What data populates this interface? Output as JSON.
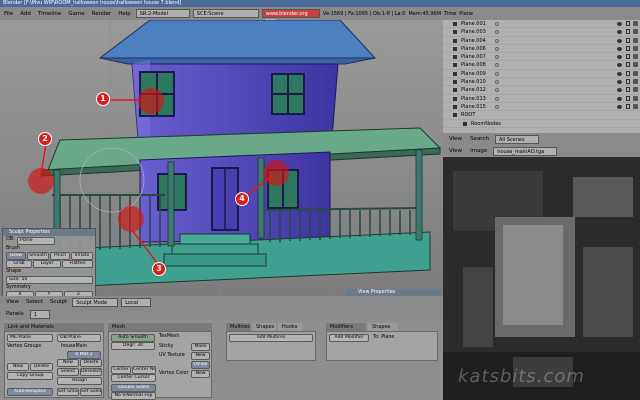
{
  "title_bar": "Blender [F:\\Mvu WIP\\ROOM_halloween house\\halloween house 7.blend]",
  "menu": [
    "File",
    "Add",
    "Timeline",
    "Game",
    "Render",
    "Help"
  ],
  "screen_field": "SR:2-Model",
  "scene_field": "SCE:Scene",
  "url_field": "www.blender.org 243",
  "stats": "Ve:1569 | Fa:1065 | Ob:1-8 | La:0",
  "mem": "Mem:45.96M",
  "time": "Time",
  "active_object": "Plane",
  "outliner": {
    "rows": [
      "Plane.001",
      "Plane.003",
      "Plane.004",
      "Plane.006",
      "Plane.007",
      "Plane.008",
      "Plane.009",
      "Plane.010",
      "Plane.012",
      "Plane.013",
      "Plane.015",
      "ROOT",
      "RoomNodes"
    ],
    "header": {
      "view": "View",
      "search": "Search",
      "scenes": "All Scenes"
    }
  },
  "image_editor": {
    "view": "View",
    "image": "Image",
    "file": "house_mainAO.tga"
  },
  "viewport3d_header": {
    "view": "View",
    "select": "Select",
    "sculpt": "Sculpt",
    "mode": "Sculpt Mode",
    "pivot": "Local"
  },
  "view_properties": "View Properties",
  "sculpt_props": {
    "title": "Sculpt Properties",
    "ob": "OB:",
    "ob_value": "Plane",
    "brush_label": "Brush",
    "brushes": [
      "Draw",
      "Smooth",
      "Pinch",
      "Inflate",
      "Grab",
      "Layer",
      "Flatten"
    ],
    "shape_label": "Shape",
    "size": "Size: 50",
    "symmetry_label": "Symmetry",
    "axes": [
      "X",
      "Y",
      "Z"
    ]
  },
  "buttons_header": {
    "panels": "Panels",
    "frame": "1"
  },
  "buttons": {
    "link_title": "Link and Materials",
    "me_field": "ME:Plane",
    "ob_field": "OB:Plane",
    "vertex_groups": "Vertex Groups",
    "house_main": "houseMain",
    "mat_count": "0 Mat 2",
    "new": "New",
    "delete": "Delete",
    "copy_group": "Copy Group",
    "select": "Select",
    "deselect": "Deselect",
    "assign": "Assign",
    "autotex": "AutoTexSpace",
    "set_smooth": "Set Smoot",
    "set_solid": "Set Solid",
    "mesh_title": "Mesh",
    "auto_smooth": "Auto Smooth",
    "degr": "Degr: 30",
    "center": "Center",
    "center_new": "Center New",
    "center_cursor": "Center Cursor",
    "double_sided": "Double Sided",
    "no_vnormal": "No V.Normal Flip",
    "texmesh_label": "TexMesh",
    "sticky": "Sticky",
    "uv_texture": "UV Texture",
    "vertex_color": "Vertex Color",
    "make": "Make",
    "new_btn": "New",
    "uvtex": "UVTex",
    "multires_tabs": [
      "Multires",
      "Shapes",
      "Hooks"
    ],
    "add_multires": "Add Multires",
    "modifiers_tabs": [
      "Modifiers",
      "Shapes"
    ],
    "add_modifier": "Add Modifier",
    "to_plane": "To: Plane"
  },
  "callouts": [
    "1",
    "2",
    "3",
    "4"
  ],
  "watermark": "katsbits.com",
  "colors": {
    "house_wall": "#5a4fc4",
    "roof": "#4a7fc0",
    "porch": "#4fa090",
    "window": "#3a8a6a"
  }
}
